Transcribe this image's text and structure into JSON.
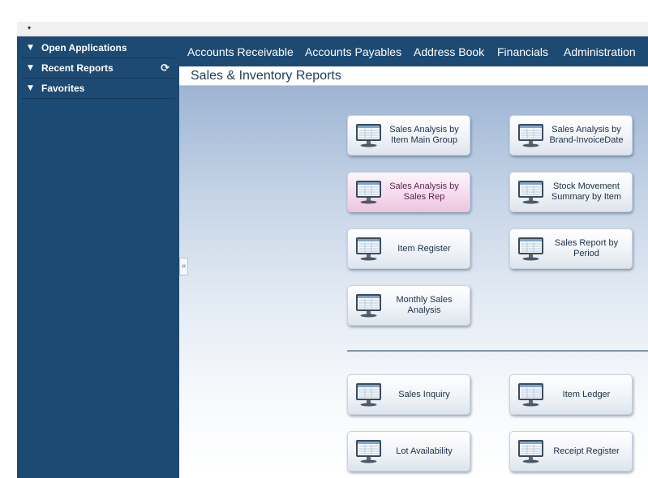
{
  "topbar": {
    "caret": "▾"
  },
  "sidebar": {
    "items": [
      {
        "label": "Open Applications",
        "toggle": "▼"
      },
      {
        "label": "Recent Reports",
        "toggle": "▼",
        "action": "⟳"
      },
      {
        "label": "Favorites",
        "toggle": "▼"
      }
    ]
  },
  "nav": {
    "items": [
      "Accounts Receivable",
      "Accounts Payables",
      "Address Book",
      "Financials",
      "Administration"
    ]
  },
  "page": {
    "title": "Sales & Inventory Reports"
  },
  "collapse": {
    "glyph": "«"
  },
  "reports": [
    "Sales Analysis by Item Main Group",
    "Sales Analysis by Brand-InvoiceDate",
    "Sales Analysis by Sales Rep",
    "Stock Movement Summary by Item",
    "Item Register",
    "Sales Report by Period",
    "Monthly Sales Analysis"
  ],
  "inquiries": [
    "Sales Inquiry",
    "Item Ledger",
    "Lot Availability",
    "Receipt Register"
  ],
  "colors": {
    "nav_bg": "#1d4a72",
    "highlight": "#f5d9ec"
  }
}
